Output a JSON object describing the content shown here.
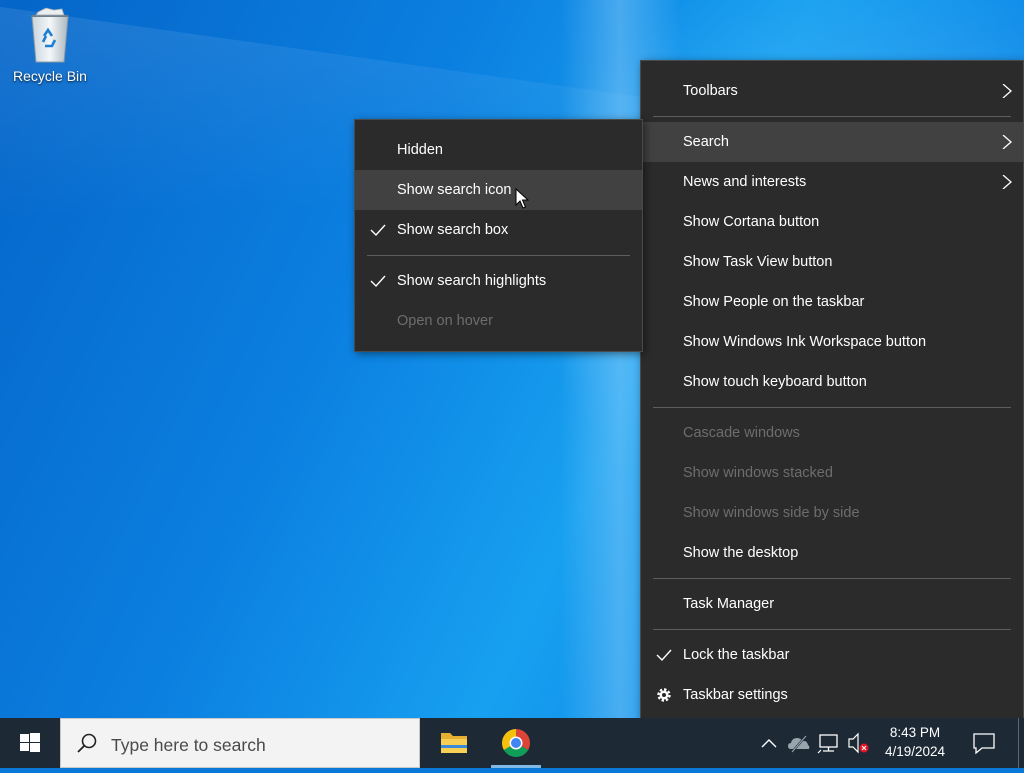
{
  "desktop": {
    "icons": [
      {
        "label": "Recycle Bin",
        "icon": "recycle-bin-icon"
      }
    ]
  },
  "taskbar_menu": {
    "items": [
      {
        "label": "Toolbars",
        "submenu": true
      },
      {
        "label": "Search",
        "submenu": true,
        "highlighted": true
      },
      {
        "label": "News and interests",
        "submenu": true
      },
      {
        "label": "Show Cortana button"
      },
      {
        "label": "Show Task View button"
      },
      {
        "label": "Show People on the taskbar"
      },
      {
        "label": "Show Windows Ink Workspace button"
      },
      {
        "label": "Show touch keyboard button"
      },
      {
        "label": "Cascade windows",
        "disabled": true
      },
      {
        "label": "Show windows stacked",
        "disabled": true
      },
      {
        "label": "Show windows side by side",
        "disabled": true
      },
      {
        "label": "Show the desktop"
      },
      {
        "label": "Task Manager"
      },
      {
        "label": "Lock the taskbar",
        "checked": true
      },
      {
        "label": "Taskbar settings",
        "icon": "gear-icon"
      }
    ]
  },
  "search_submenu": {
    "items": [
      {
        "label": "Hidden"
      },
      {
        "label": "Show search icon",
        "highlighted": true
      },
      {
        "label": "Show search box",
        "checked": true
      },
      {
        "label": "Show search highlights",
        "checked": true
      },
      {
        "label": "Open on hover",
        "disabled": true
      }
    ]
  },
  "taskbar": {
    "search_placeholder": "Type here to search",
    "apps": [
      {
        "name": "File Explorer",
        "icon": "file-explorer-icon",
        "active": false
      },
      {
        "name": "Google Chrome",
        "icon": "chrome-icon",
        "active": true
      }
    ],
    "tray_icons": [
      "chevron-up-icon",
      "onedrive-offline-icon",
      "network-icon",
      "volume-muted-icon"
    ],
    "time": "8:43 PM",
    "date": "4/19/2024"
  },
  "colors": {
    "menu_bg": "#2b2b2b",
    "menu_highlight": "#414141",
    "taskbar_bg": "#1d2a36",
    "desktop_accent": "#0a78d7"
  }
}
